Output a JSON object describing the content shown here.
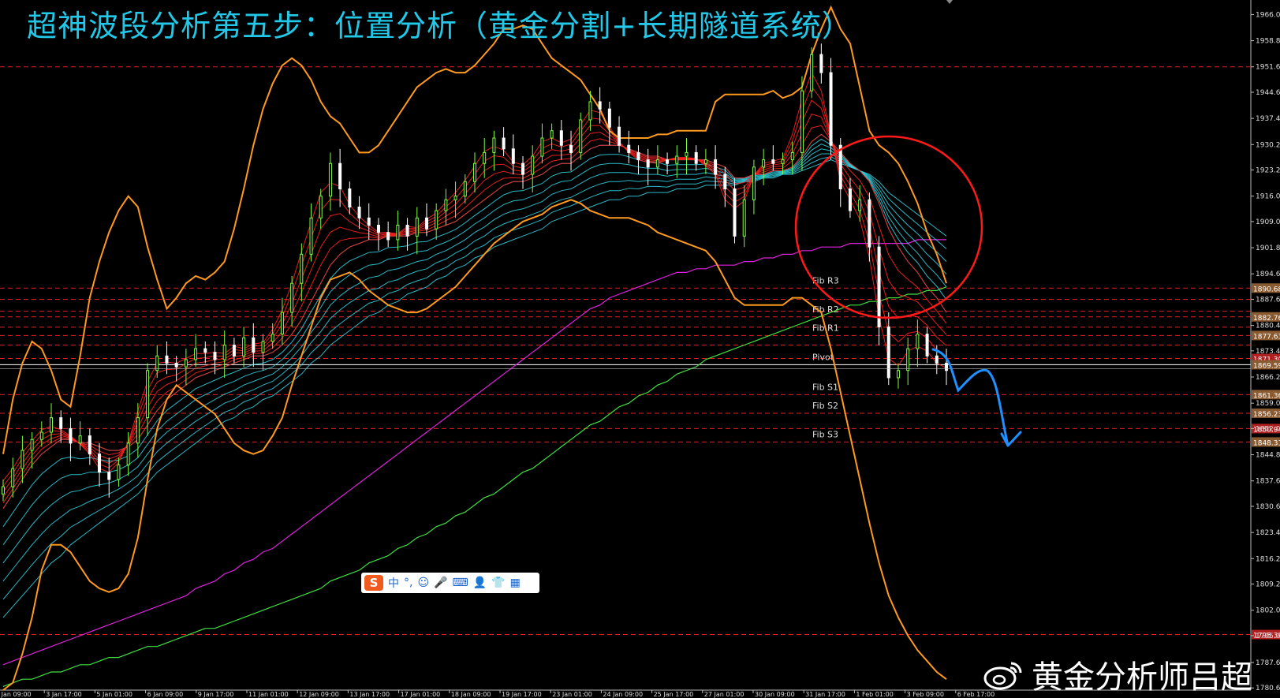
{
  "title": "超神波段分析第五步：位置分析（黄金分割+长期隧道系统）",
  "watermark": "黄金分析师吕超",
  "ime_toolbar": {
    "logo": "S",
    "items": [
      "中",
      "°,",
      "☺",
      "🎤",
      "⌨",
      "👤",
      "👕",
      "▦"
    ]
  },
  "colors": {
    "background": "#000000",
    "bull_candle": "#7fff3f",
    "bear_candle": "#ffffff",
    "bollinger": "#ff9a1e",
    "ma_fast": "#ff2020",
    "ma_tunnel": "#30d8e8",
    "ma_magenta": "#e020e0",
    "ma_green": "#40e040",
    "pivot_line": "#ffffff",
    "level_line": "#e02020",
    "annotation_circle": "#ff1a1a",
    "annotation_arrow": "#1e90ff"
  },
  "chart_data": {
    "type": "line",
    "symbol": "XAUUSD",
    "ylim": [
      1780,
      1970
    ],
    "y_ticks": [
      "1966.00",
      "1958.80",
      "1951.60",
      "1944.60",
      "1937.40",
      "1930.20",
      "1923.20",
      "1916.00",
      "1909.00",
      "1901.80",
      "1894.60",
      "1887.60",
      "1880.40",
      "1873.40",
      "1866.20",
      "1859.00",
      "1852.00",
      "1844.80",
      "1837.60",
      "1830.60",
      "1823.40",
      "1816.20",
      "1809.20",
      "1802.00",
      "1795.00",
      "1787.60",
      "1780.60"
    ],
    "x_ticks": [
      "2 Jan 09:00",
      "3 Jan 17:00",
      "5 Jan 01:00",
      "6 Jan 09:00",
      "9 Jan 17:00",
      "11 Jan 01:00",
      "12 Jan 09:00",
      "13 Jan 17:00",
      "17 Jan 01:00",
      "18 Jan 09:00",
      "19 Jan 17:00",
      "23 Jan 01:00",
      "24 Jan 09:00",
      "25 Jan 17:00",
      "27 Jan 01:00",
      "30 Jan 09:00",
      "31 Jan 17:00",
      "1 Feb 01:00",
      "3 Feb 09:00",
      "6 Feb 17:00"
    ],
    "levels": [
      {
        "label": "Fib R3",
        "value": 1890.68,
        "price_tag": "1890.68"
      },
      {
        "label": "Fib R2",
        "value": 1882.76,
        "price_tag": "1882.76"
      },
      {
        "label": "Fib R1",
        "value": 1877.63,
        "price_tag": "1877.63"
      },
      {
        "label": "Pivot",
        "value": 1869.59,
        "price_tag": "1869.59"
      },
      {
        "label": "Fib S1",
        "value": 1861.36,
        "price_tag": "1861.36"
      },
      {
        "label": "Fib S2",
        "value": 1856.23,
        "price_tag": "1856.23"
      },
      {
        "label": "Fib S3",
        "value": 1848.31,
        "price_tag": "1848.31"
      }
    ],
    "extra_levels": [
      {
        "value": 1951.6
      },
      {
        "value": 1887.6
      },
      {
        "value": 1884.3
      },
      {
        "value": 1879.9
      },
      {
        "value": 1875.0
      },
      {
        "value": 1871.3,
        "price_tag": "1871.30"
      },
      {
        "value": 1852.0,
        "price_tag": "1850.94"
      },
      {
        "value": 1795.3,
        "price_tag": "1795.30"
      }
    ],
    "current_price": 1868.5,
    "close_series": [
      1836,
      1841,
      1846,
      1849,
      1851,
      1855,
      1852,
      1848,
      1850,
      1845,
      1840,
      1838,
      1842,
      1848,
      1855,
      1868,
      1872,
      1870,
      1869,
      1871,
      1874,
      1873,
      1871,
      1875,
      1872,
      1877,
      1873,
      1876,
      1878,
      1884,
      1892,
      1900,
      1910,
      1916,
      1925,
      1918,
      1913,
      1910,
      1908,
      1906,
      1904,
      1908,
      1905,
      1910,
      1907,
      1912,
      1915,
      1916,
      1920,
      1925,
      1928,
      1932,
      1929,
      1925,
      1922,
      1927,
      1932,
      1934,
      1930,
      1928,
      1937,
      1942,
      1940,
      1935,
      1930,
      1928,
      1926,
      1924,
      1926,
      1925,
      1927,
      1928,
      1925,
      1926,
      1922,
      1918,
      1905,
      1915,
      1924,
      1926,
      1925,
      1926,
      1928,
      1945,
      1955,
      1950,
      1930,
      1918,
      1912,
      1915,
      1902,
      1880,
      1866,
      1868,
      1874,
      1878,
      1872,
      1870,
      1868
    ],
    "tunnel_fast": [
      1830,
      1834,
      1838,
      1842,
      1845,
      1847,
      1849,
      1849,
      1848,
      1848,
      1847,
      1846,
      1846,
      1847,
      1849,
      1853,
      1857,
      1860,
      1862,
      1864,
      1866,
      1867,
      1868,
      1869,
      1870,
      1871,
      1872,
      1872,
      1873,
      1875,
      1878,
      1882,
      1887,
      1892,
      1897,
      1900,
      1902,
      1903,
      1904,
      1904,
      1905,
      1905,
      1905,
      1906,
      1906,
      1907,
      1908,
      1909,
      1911,
      1913,
      1915,
      1917,
      1919,
      1920,
      1920,
      1921,
      1922,
      1924,
      1925,
      1925,
      1927,
      1929,
      1930,
      1930,
      1930,
      1929,
      1928,
      1927,
      1927,
      1926,
      1926,
      1926,
      1926,
      1926,
      1925,
      1924,
      1921,
      1921,
      1922,
      1922,
      1923,
      1923,
      1924,
      1927,
      1931,
      1933,
      1931,
      1928,
      1925,
      1923,
      1920,
      1914,
      1907,
      1902,
      1898,
      1895,
      1891,
      1888,
      1884
    ],
    "tunnel_slow": [
      1800,
      1803,
      1806,
      1809,
      1812,
      1815,
      1817,
      1820,
      1822,
      1824,
      1826,
      1828,
      1830,
      1832,
      1834,
      1837,
      1840,
      1842,
      1844,
      1846,
      1848,
      1850,
      1852,
      1854,
      1855,
      1857,
      1858,
      1860,
      1861,
      1863,
      1865,
      1867,
      1870,
      1872,
      1875,
      1877,
      1879,
      1881,
      1883,
      1884,
      1886,
      1887,
      1889,
      1890,
      1891,
      1893,
      1894,
      1896,
      1897,
      1899,
      1900,
      1902,
      1903,
      1904,
      1905,
      1906,
      1907,
      1909,
      1910,
      1911,
      1912,
      1913,
      1914,
      1915,
      1915,
      1916,
      1916,
      1917,
      1917,
      1917,
      1918,
      1918,
      1918,
      1919,
      1919,
      1919,
      1919,
      1920,
      1920,
      1921,
      1921,
      1922,
      1922,
      1923,
      1924,
      1925,
      1926,
      1925,
      1924,
      1923,
      1922,
      1920,
      1917,
      1915,
      1913,
      1911,
      1909,
      1907,
      1905
    ],
    "ma_magenta": [
      1787,
      1788,
      1789,
      1790,
      1791,
      1792,
      1793,
      1794,
      1795,
      1796,
      1797,
      1798,
      1799,
      1800,
      1801,
      1802,
      1803,
      1804,
      1805,
      1806,
      1808,
      1809,
      1810,
      1812,
      1813,
      1815,
      1816,
      1818,
      1819,
      1821,
      1823,
      1825,
      1827,
      1829,
      1831,
      1833,
      1835,
      1837,
      1839,
      1841,
      1843,
      1845,
      1847,
      1849,
      1851,
      1853,
      1855,
      1857,
      1859,
      1861,
      1863,
      1865,
      1867,
      1869,
      1871,
      1873,
      1875,
      1877,
      1879,
      1881,
      1883,
      1885,
      1886,
      1888,
      1889,
      1890,
      1891,
      1892,
      1893,
      1894,
      1895,
      1895,
      1896,
      1896,
      1897,
      1897,
      1897,
      1898,
      1898,
      1899,
      1899,
      1900,
      1900,
      1901,
      1901,
      1902,
      1902,
      1902,
      1903,
      1903,
      1903,
      1903,
      1903,
      1903,
      1903,
      1904,
      1904,
      1904,
      1904
    ],
    "ma_green": [
      1781,
      1782,
      1783,
      1783,
      1784,
      1785,
      1785,
      1786,
      1787,
      1787,
      1788,
      1789,
      1789,
      1790,
      1791,
      1792,
      1792,
      1793,
      1794,
      1795,
      1796,
      1797,
      1797,
      1798,
      1799,
      1800,
      1801,
      1802,
      1803,
      1804,
      1805,
      1806,
      1807,
      1808,
      1810,
      1811,
      1812,
      1813,
      1815,
      1816,
      1817,
      1819,
      1820,
      1822,
      1823,
      1825,
      1826,
      1828,
      1829,
      1831,
      1833,
      1834,
      1836,
      1838,
      1840,
      1841,
      1843,
      1845,
      1847,
      1849,
      1851,
      1853,
      1854,
      1856,
      1858,
      1859,
      1861,
      1862,
      1864,
      1865,
      1867,
      1868,
      1869,
      1871,
      1872,
      1873,
      1874,
      1875,
      1876,
      1877,
      1878,
      1879,
      1880,
      1881,
      1882,
      1883,
      1884,
      1885,
      1886,
      1886,
      1887,
      1887,
      1888,
      1888,
      1889,
      1889,
      1890,
      1890,
      1891
    ],
    "bb_upper": [
      1845,
      1860,
      1870,
      1876,
      1874,
      1868,
      1860,
      1858,
      1872,
      1888,
      1898,
      1906,
      1912,
      1916,
      1913,
      1902,
      1893,
      1885,
      1888,
      1892,
      1894,
      1893,
      1895,
      1898,
      1907,
      1918,
      1930,
      1940,
      1947,
      1952,
      1954,
      1952,
      1948,
      1942,
      1938,
      1936,
      1932,
      1928,
      1928,
      1930,
      1934,
      1938,
      1942,
      1946,
      1948,
      1950,
      1951,
      1950,
      1950,
      1952,
      1955,
      1958,
      1962,
      1962,
      1963,
      1962,
      1958,
      1954,
      1952,
      1950,
      1948,
      1944,
      1940,
      1934,
      1932,
      1932,
      1932,
      1932,
      1933,
      1933,
      1934,
      1934,
      1934,
      1934,
      1942,
      1944,
      1944,
      1944,
      1944,
      1944,
      1945,
      1943,
      1944,
      1946,
      1955,
      1962,
      1968,
      1962,
      1958,
      1946,
      1934,
      1930,
      1928,
      1925,
      1920,
      1914,
      1906,
      1900,
      1892
    ],
    "bb_lower": [
      1780,
      1782,
      1790,
      1800,
      1813,
      1820,
      1820,
      1818,
      1814,
      1810,
      1808,
      1807,
      1808,
      1812,
      1822,
      1838,
      1852,
      1860,
      1864,
      1862,
      1860,
      1858,
      1856,
      1852,
      1848,
      1846,
      1845,
      1846,
      1850,
      1855,
      1864,
      1872,
      1880,
      1888,
      1893,
      1894,
      1895,
      1893,
      1890,
      1888,
      1886,
      1885,
      1884,
      1884,
      1885,
      1887,
      1889,
      1891,
      1894,
      1897,
      1900,
      1903,
      1905,
      1907,
      1909,
      1910,
      1911,
      1913,
      1914,
      1915,
      1914,
      1912,
      1911,
      1910,
      1910,
      1910,
      1909,
      1908,
      1906,
      1905,
      1904,
      1903,
      1902,
      1901,
      1898,
      1893,
      1888,
      1886,
      1886,
      1886,
      1886,
      1886,
      1888,
      1888,
      1886,
      1884,
      1874,
      1862,
      1850,
      1838,
      1826,
      1815,
      1806,
      1800,
      1795,
      1791,
      1788,
      1785,
      1783
    ]
  }
}
